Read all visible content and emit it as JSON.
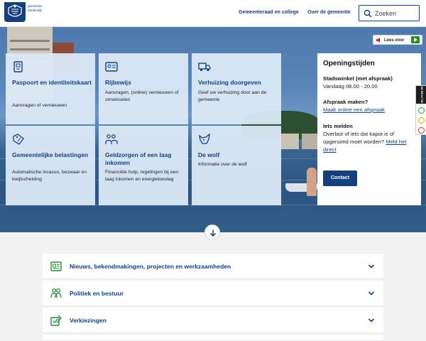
{
  "header": {
    "logo_text": "gemeente harderwijk",
    "nav": [
      "Gemeenteraad en college",
      "Over de gemeente"
    ],
    "search_placeholder": "Zoeken"
  },
  "lees_voor": "Lees voor",
  "tiles": [
    {
      "title": "Paspoort en identiteitskaart",
      "desc": "Aanvragen of vernieuwen",
      "icon": "passport-icon"
    },
    {
      "title": "Rijbewijs",
      "desc": "Aanvragen, (online) vernieuwen of omwisselen",
      "icon": "driving-license-icon"
    },
    {
      "title": "Verhuizing doorgeven",
      "desc": "Geef uw verhuizing door aan de gemeente",
      "icon": "moving-truck-icon"
    },
    {
      "title": "Gemeentelijke belastingen",
      "desc": "Automatische incasso, bezwaar en kwijtschelding",
      "icon": "tax-tag-icon"
    },
    {
      "title": "Geldzorgen of een laag inkomen",
      "desc": "Financiële hulp, regelingen bij een laag inkomen en energietoeslag",
      "icon": "money-help-icon"
    },
    {
      "title": "De wolf",
      "desc": "Informatie over de wolf",
      "icon": "wolf-icon"
    }
  ],
  "hours": {
    "title": "Openingstijden",
    "stadswinkel_label": "Stadswinkel (met afspraak)",
    "stadswinkel_time": "Vandaag 08.00 - 20.00",
    "afspraak_label": "Afspraak maken?",
    "afspraak_link": "Maak online een afspraak",
    "melden_label": "Iets melden",
    "melden_text": "Overlast of iets dat kapot is of opgeruimd moet worden?",
    "melden_link": "Meld het direct",
    "contact_button": "Contact"
  },
  "feedback_label": "UW REACTIE",
  "accordion": [
    {
      "label": "Nieuws, bekendmakingen, projecten en werkzaamheden",
      "icon": "newspaper-icon"
    },
    {
      "label": "Politiek en bestuur",
      "icon": "people-icon"
    },
    {
      "label": "Verkiezingen",
      "icon": "ballot-icon"
    }
  ],
  "colors": {
    "brand": "#15407c",
    "tile_bg": "#dce9f7"
  }
}
